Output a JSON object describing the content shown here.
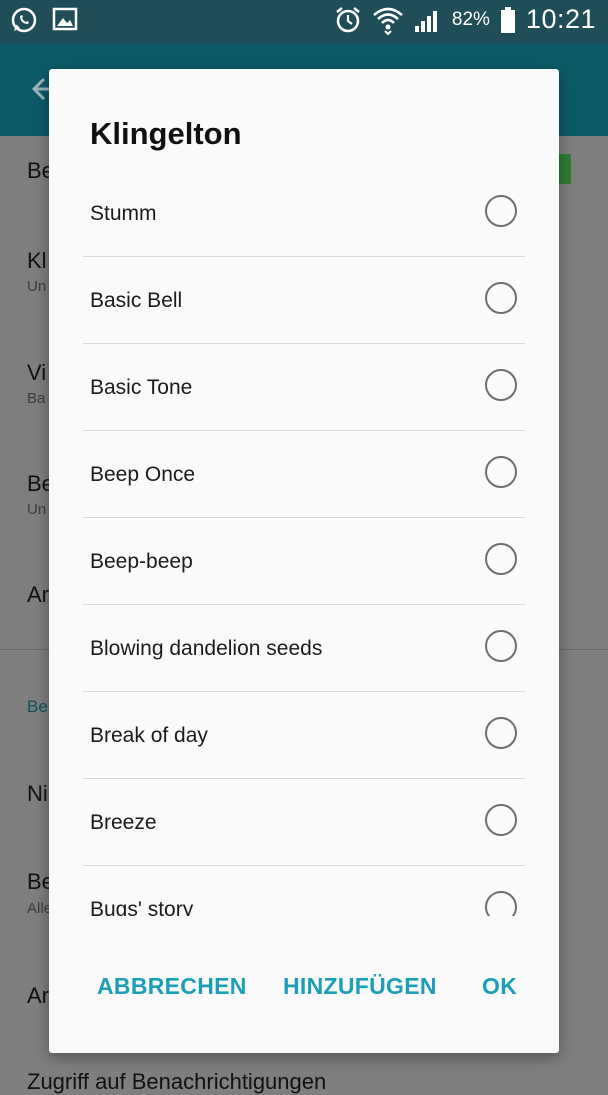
{
  "status_bar": {
    "left_icons": [
      "whatsapp-icon",
      "gallery-icon"
    ],
    "right_icons": [
      "alarm-icon",
      "wifi-icon",
      "signal-icon",
      "battery-icon"
    ],
    "battery": "82%",
    "clock": "10:21"
  },
  "background": {
    "items": [
      {
        "label": "Be",
        "sub": ""
      },
      {
        "label": "Kl",
        "sub": "Un"
      },
      {
        "label": "Vi",
        "sub": "Ba"
      },
      {
        "label": "Be",
        "sub": "Un"
      },
      {
        "label": "Ar",
        "sub": ""
      }
    ],
    "section_header": "Be",
    "items_after": [
      {
        "label": "Ni",
        "sub": ""
      },
      {
        "label": "Be",
        "sub": "Alle"
      },
      {
        "label": "Ar",
        "sub": ""
      },
      {
        "label": "Zugriff auf Benachrichtigungen",
        "sub": ""
      }
    ]
  },
  "dialog": {
    "title": "Klingelton",
    "options": [
      "Stumm",
      "Basic Bell",
      "Basic Tone",
      "Beep Once",
      "Beep-beep",
      "Blowing dandelion seeds",
      "Break of day",
      "Breeze",
      "Bugs' story"
    ],
    "buttons": {
      "cancel": "ABBRECHEN",
      "add": "HINZUFÜGEN",
      "ok": "OK"
    }
  },
  "colors": {
    "accent": "#1b9fb7",
    "status_bar": "#1f4e58",
    "app_bar": "#0c5a68"
  }
}
